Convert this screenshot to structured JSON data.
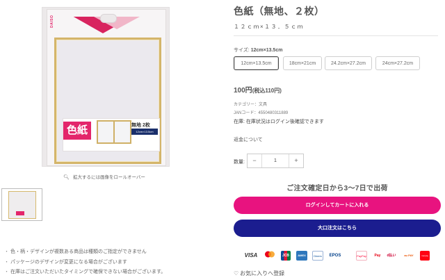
{
  "product": {
    "title": "色紙（無地、２枚）",
    "subtitle": "１２ｃｍ×１３．５ｃｍ",
    "size_label_prefix": "サイズ:",
    "size_label_value": "12cm×13.5cm",
    "size_options": [
      "12cm×13.5cm",
      "18cm×21cm",
      "24.2cm×27.2cm",
      "24cm×27.2cm"
    ],
    "price": "100円",
    "price_tax": "(税込110円)",
    "category": "カテゴリー：文具",
    "jan": "JANコード：4550480311889",
    "stock": "在庫:  在庫状況はログイン後確認できます",
    "returns": "返金について",
    "qty_label": "数量:",
    "qty_value": "1",
    "qty_minus": "−",
    "qty_plus": "+",
    "ship_message": "ご注文確定日から3〜7日で出荷",
    "login_cart_button": "ログインしてカートに入れる",
    "bulk_order_button": "大口注文はこちら",
    "favorite_label": "お気に入りへ登録"
  },
  "gallery": {
    "zoom_hint": "拡大するには画像をロールオーバー",
    "package_big_text": "色紙",
    "package_count": "無地  2枚",
    "package_size": "12cm×13.5cm",
    "package_logo": "DAISO"
  },
  "notes": [
    "色・柄・デザインが複数ある商品は種類のご指定ができません",
    "パッケージのデザインが変更になる場合がございます",
    "在庫はご注文いただいたタイミングで確保できない場合がございます。"
  ],
  "payment_methods": [
    {
      "label": "VISA",
      "color": "#1a1f71",
      "icon": "visa-icon"
    },
    {
      "label": "MC",
      "color": "#eb001b",
      "icon": "mastercard-icon"
    },
    {
      "label": "JCB",
      "color": "#0e4c96",
      "icon": "jcb-icon"
    },
    {
      "label": "AMEX",
      "color": "#2e77bc",
      "icon": "amex-icon"
    },
    {
      "label": "Diners",
      "color": "#004a97",
      "icon": "diners-icon"
    },
    {
      "label": "EPOS",
      "color": "#003f8a",
      "icon": "epos-icon"
    },
    {
      "label": "PayPay",
      "color": "#ff0033",
      "icon": "paypay-icon"
    },
    {
      "label": "Pay",
      "color": "#e60012",
      "icon": "rakuten-pay-icon"
    },
    {
      "label": "d払い",
      "color": "#cc0033",
      "icon": "d-barai-icon"
    },
    {
      "label": "au PAY",
      "color": "#eb5505",
      "icon": "au-pay-icon"
    },
    {
      "label": "merpay",
      "color": "#ff0211",
      "icon": "merpay-icon"
    }
  ],
  "colors": {
    "login_button": "#e8137f",
    "bulk_button": "#1b1d8f"
  }
}
